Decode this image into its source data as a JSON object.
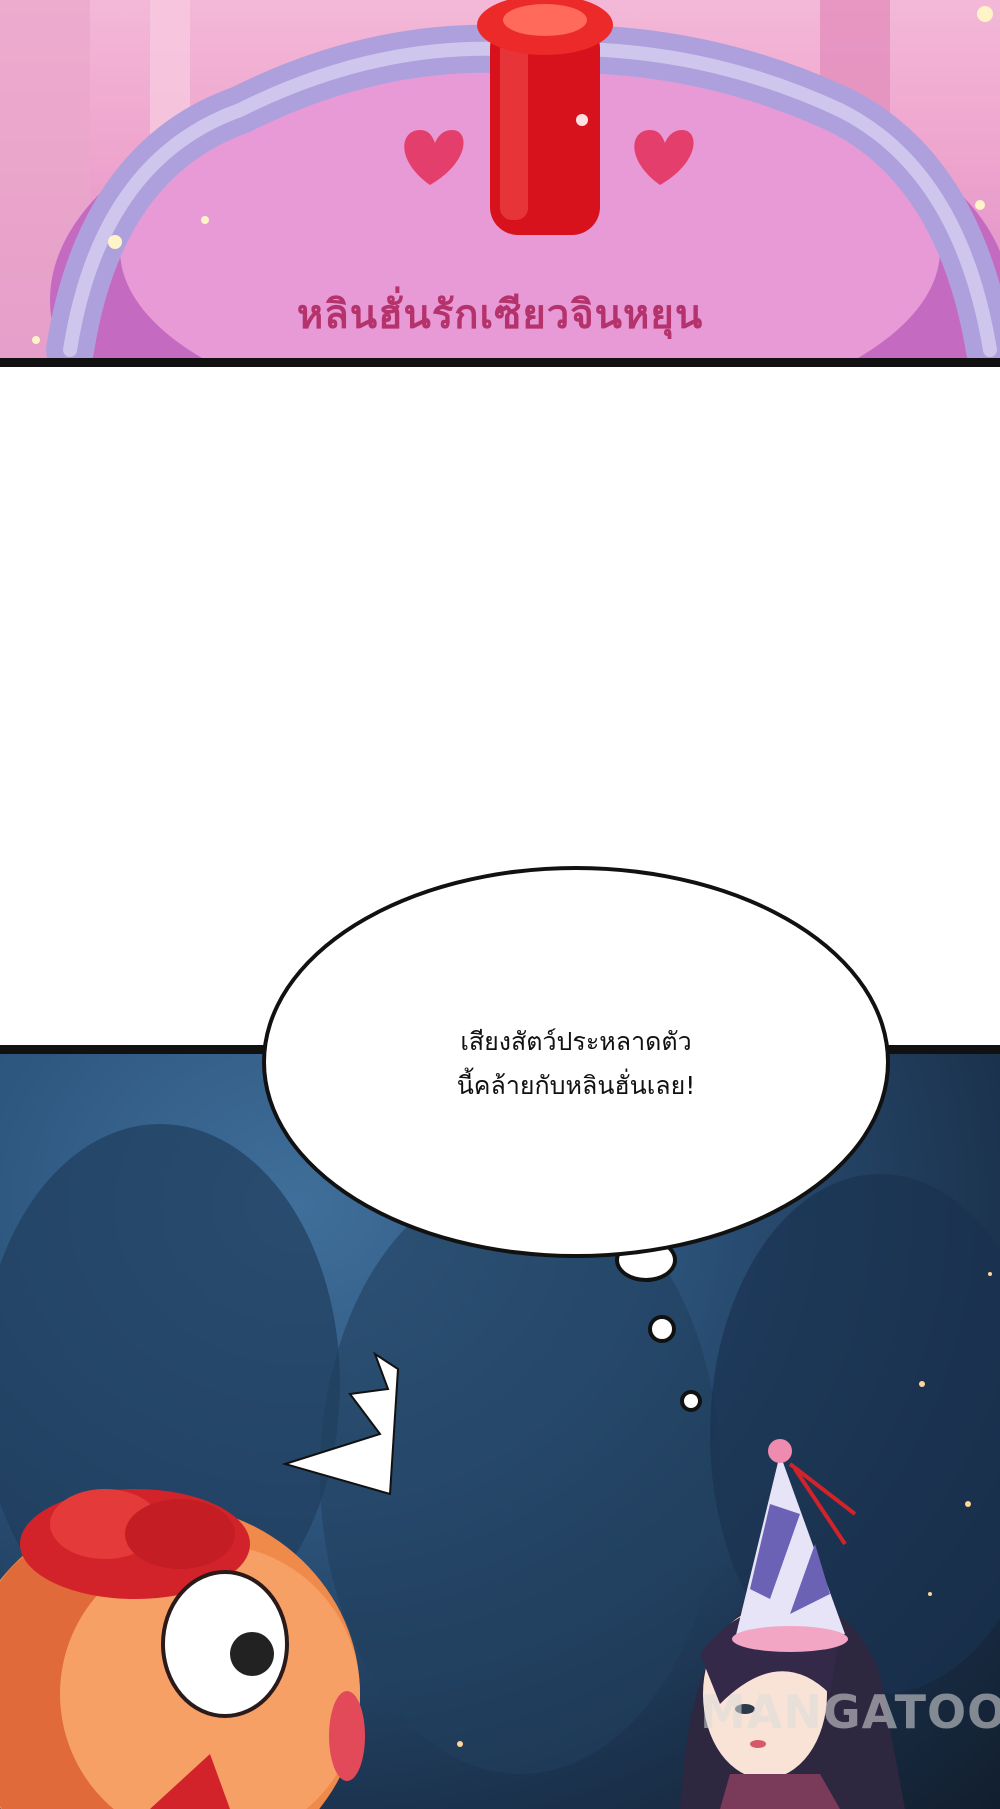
{
  "panels": {
    "top": {
      "cake_text": "หลินฮั่นรักเซียวจินหยุน",
      "colors": {
        "background": "#eea4cd",
        "frosting": "#b3a6e0",
        "candle": "#d8121c",
        "text": "#b5336c"
      },
      "icons": [
        "heart-icon",
        "heart-icon",
        "candle-icon"
      ]
    },
    "bottom": {
      "speech_bubble": {
        "line1": "เสียงสัตว์ประหลาดตัว",
        "line2": "นี้คล้ายกับหลินฮั่นเลย!"
      },
      "watermark": "MANGATOON",
      "colors": {
        "background": "#2d557d",
        "fish": "#f08a4a",
        "fish_crest": "#d2232a",
        "party_hat": "#f3a6c4"
      }
    }
  }
}
